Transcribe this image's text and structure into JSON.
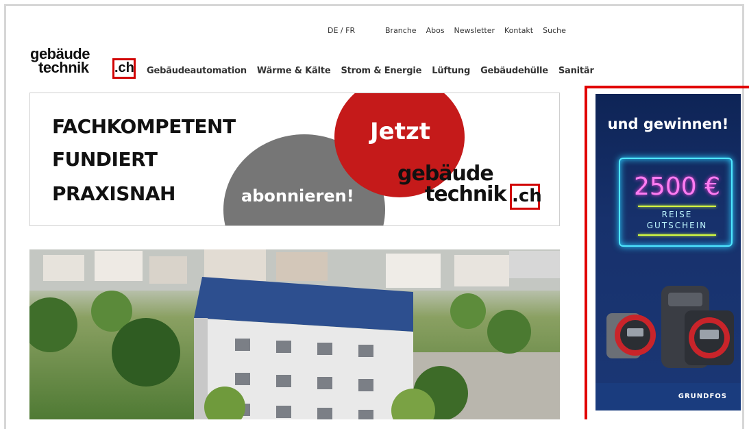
{
  "header": {
    "lang_switch": "DE / FR",
    "top_links": [
      "Branche",
      "Abos",
      "Newsletter",
      "Kontakt",
      "Suche"
    ],
    "logo": {
      "line1": "gebäude",
      "line2": "technik",
      "suffix": ".ch"
    },
    "main_nav": [
      "Gebäudeautomation",
      "Wärme & Kälte",
      "Strom & Energie",
      "Lüftung",
      "Gebäudehülle",
      "Sanitär"
    ]
  },
  "banner": {
    "line1": "FACHKOMPETENT",
    "line2": "FUNDIERT",
    "line3": "PRAXISNAH",
    "cta_top": "Jetzt",
    "cta_bottom": "abonnieren!",
    "logo_line1": "gebäude",
    "logo_line2": "technik",
    "logo_suffix": ".ch"
  },
  "ad": {
    "headline": "und gewinnen!",
    "amount": "2500 €",
    "line_a": "REISE",
    "line_b": "GUTSCHEIN",
    "brand": "GRUNDFOS"
  },
  "colors": {
    "accent_red": "#d10000",
    "ad_blue": "#17316c",
    "neon_cyan": "#4fe7ff",
    "neon_pink": "#ff7cf2"
  }
}
